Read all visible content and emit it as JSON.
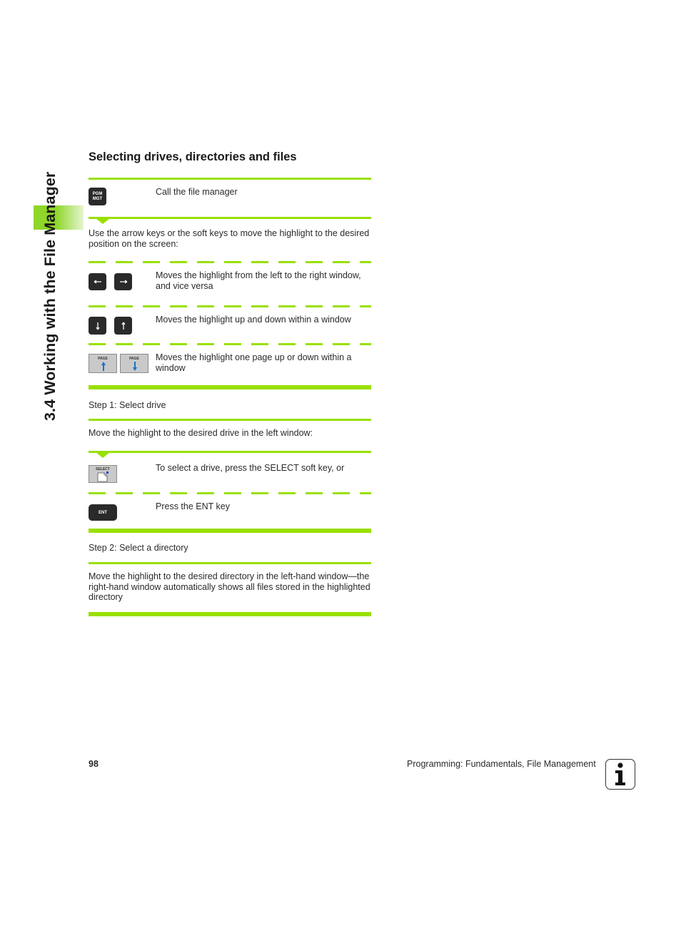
{
  "side_title": "3.4 Working with the File Manager",
  "heading": "Selecting drives, directories and files",
  "rows": {
    "call_fm": {
      "key_label": "PGM MGT",
      "key_line1": "PGM",
      "key_line2": "MGT",
      "text": "Call the file manager"
    },
    "intro": "Use the arrow keys or the soft keys to move the highlight to the desired position on the screen:",
    "left_right": {
      "text": "Moves the highlight from the left to the right window, and vice versa",
      "icons": [
        "arrow-left-key",
        "arrow-right-key"
      ]
    },
    "up_down": {
      "text": "Moves the highlight up and down within a window",
      "icons": [
        "arrow-down-key",
        "arrow-up-key"
      ]
    },
    "page": {
      "text": "Moves the highlight one page up or down within a window",
      "key_label": "PAGE"
    },
    "step1": "Step 1: Select drive",
    "step1_desc": "Move the highlight to the desired drive in the left window:",
    "select": {
      "key_label": "SELECT",
      "text": "To select a drive, press the SELECT soft key, or"
    },
    "ent": {
      "key_label": "ENT",
      "text": "Press the ENT key"
    },
    "step2": "Step 2: Select a directory",
    "step2_desc": "Move the highlight to the desired directory in the left-hand window—the right-hand window automatically shows all files stored in the highlighted directory"
  },
  "footer": {
    "page_number": "98",
    "title": "Programming: Fundamentals, File Management",
    "info_icon": "i"
  },
  "colors": {
    "accent": "#99e000",
    "side_tab": "#8fd62a",
    "key_dark": "#2a2a2a",
    "arrow_blue": "#1a6fd0"
  }
}
